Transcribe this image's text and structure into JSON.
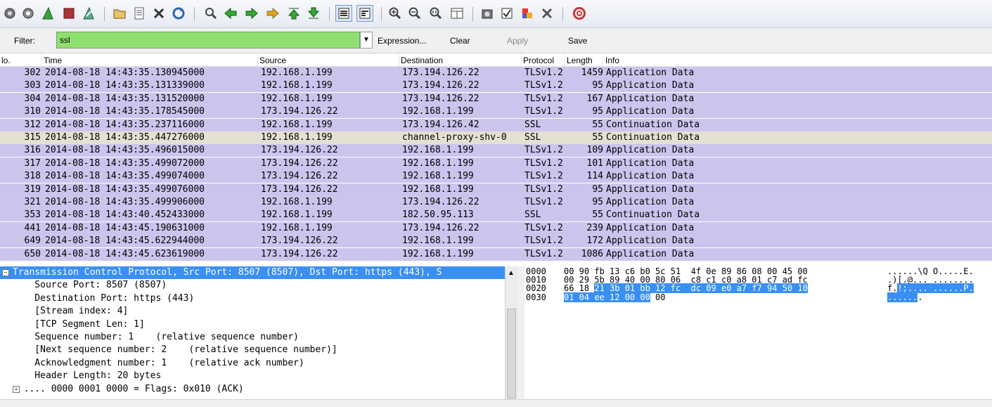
{
  "toolbar": {
    "icons": [
      "interface-list-icon",
      "capture-options-icon",
      "start-capture-icon",
      "stop-capture-icon",
      "restart-capture-icon",
      "open-file-icon",
      "save-file-icon",
      "close-file-icon",
      "reload-icon",
      "find-packet-icon",
      "go-back-icon",
      "go-forward-icon",
      "go-to-packet-icon",
      "go-first-icon",
      "go-last-icon",
      "colorize-icon",
      "autoscroll-icon",
      "zoom-in-icon",
      "zoom-out-icon",
      "normal-size-icon",
      "resize-columns-icon",
      "capture-filters-icon",
      "display-filters-icon",
      "coloring-rules-icon",
      "preferences-icon",
      "help-icon"
    ]
  },
  "filterbar": {
    "label": "Filter:",
    "value": "ssl",
    "expression": "Expression...",
    "clear": "Clear",
    "apply": "Apply",
    "save": "Save"
  },
  "packet_list": {
    "columns": [
      "lo.",
      "Time",
      "Source",
      "Destination",
      "Protocol",
      "Length",
      "Info"
    ],
    "rows": [
      {
        "no": "302",
        "time": "2014-08-18 14:43:35.130945000",
        "src": "192.168.1.199",
        "dst": "173.194.126.22",
        "proto": "TLSv1.2",
        "len": "1459",
        "info": "Application Data"
      },
      {
        "no": "303",
        "time": "2014-08-18 14:43:35.131339000",
        "src": "192.168.1.199",
        "dst": "173.194.126.22",
        "proto": "TLSv1.2",
        "len": "95",
        "info": "Application Data"
      },
      {
        "no": "304",
        "time": "2014-08-18 14:43:35.131520000",
        "src": "192.168.1.199",
        "dst": "173.194.126.22",
        "proto": "TLSv1.2",
        "len": "167",
        "info": "Application Data"
      },
      {
        "no": "310",
        "time": "2014-08-18 14:43:35.178545000",
        "src": "173.194.126.22",
        "dst": "192.168.1.199",
        "proto": "TLSv1.2",
        "len": "95",
        "info": "Application Data"
      },
      {
        "no": "312",
        "time": "2014-08-18 14:43:35.237116000",
        "src": "192.168.1.199",
        "dst": "173.194.126.42",
        "proto": "SSL",
        "len": "55",
        "info": "Continuation Data"
      },
      {
        "no": "315",
        "time": "2014-08-18 14:43:35.447276000",
        "src": "192.168.1.199",
        "dst": "channel-proxy-shv-0",
        "proto": "SSL",
        "len": "55",
        "info": "Continuation Data"
      },
      {
        "no": "316",
        "time": "2014-08-18 14:43:35.496015000",
        "src": "173.194.126.22",
        "dst": "192.168.1.199",
        "proto": "TLSv1.2",
        "len": "109",
        "info": "Application Data"
      },
      {
        "no": "317",
        "time": "2014-08-18 14:43:35.499072000",
        "src": "173.194.126.22",
        "dst": "192.168.1.199",
        "proto": "TLSv1.2",
        "len": "101",
        "info": "Application Data"
      },
      {
        "no": "318",
        "time": "2014-08-18 14:43:35.499074000",
        "src": "173.194.126.22",
        "dst": "192.168.1.199",
        "proto": "TLSv1.2",
        "len": "114",
        "info": "Application Data"
      },
      {
        "no": "319",
        "time": "2014-08-18 14:43:35.499076000",
        "src": "173.194.126.22",
        "dst": "192.168.1.199",
        "proto": "TLSv1.2",
        "len": "95",
        "info": "Application Data"
      },
      {
        "no": "321",
        "time": "2014-08-18 14:43:35.499906000",
        "src": "192.168.1.199",
        "dst": "173.194.126.22",
        "proto": "TLSv1.2",
        "len": "95",
        "info": "Application Data"
      },
      {
        "no": "353",
        "time": "2014-08-18 14:43:40.452433000",
        "src": "192.168.1.199",
        "dst": "182.50.95.113",
        "proto": "SSL",
        "len": "55",
        "info": "Continuation Data"
      },
      {
        "no": "441",
        "time": "2014-08-18 14:43:45.190631000",
        "src": "192.168.1.199",
        "dst": "173.194.126.22",
        "proto": "TLSv1.2",
        "len": "239",
        "info": "Application Data"
      },
      {
        "no": "649",
        "time": "2014-08-18 14:43:45.622944000",
        "src": "173.194.126.22",
        "dst": "192.168.1.199",
        "proto": "TLSv1.2",
        "len": "172",
        "info": "Application Data"
      },
      {
        "no": "650",
        "time": "2014-08-18 14:43:45.623619000",
        "src": "173.194.126.22",
        "dst": "192.168.1.199",
        "proto": "TLSv1.2",
        "len": "1086",
        "info": "Application Data"
      }
    ],
    "selected_no": "315"
  },
  "detail": {
    "lines": [
      "Transmission Control Protocol, Src Port: 8507 (8507), Dst Port: https (443), S",
      "    Source Port: 8507 (8507)",
      "    Destination Port: https (443)",
      "    [Stream index: 4]",
      "    [TCP Segment Len: 1]",
      "    Sequence number: 1    (relative sequence number)",
      "    [Next sequence number: 2    (relative sequence number)]",
      "    Acknowledgment number: 1    (relative ack number)",
      "    Header Length: 20 bytes",
      "  .... 0000 0001 0000 = Flags: 0x010 (ACK)"
    ]
  },
  "bytes": {
    "offsets": [
      "0000",
      "0010",
      "0020",
      "0030"
    ],
    "rows": [
      {
        "pre": "00 90 fb 13 c6 b0 5c 51  4f 0e 89 86 08 00 45 00",
        "hl": "",
        "post": ""
      },
      {
        "pre": "00 29 5b 89 40 00 80 06  c8 c1 c0 a8 01 c7 ad fc",
        "hl": "",
        "post": ""
      },
      {
        "pre": "66 18 ",
        "hl": "21 3b 01 bb 12 fc  dc 09 e0 a7 f7 94 50 10",
        "post": ""
      },
      {
        "pre": "",
        "hl": "01 04 ee 12 00 00",
        "post": " 00"
      }
    ],
    "ascii": [
      {
        "pre": "......\\Q O.....E.",
        "hl": ""
      },
      {
        "pre": ".)[.@... ........",
        "hl": ""
      },
      {
        "pre": "f.",
        "hl": "!;.... ......P."
      },
      {
        "pre": "",
        "hl": "......",
        "post": "."
      }
    ]
  },
  "colors": {
    "row_bg": "#cbc5ee",
    "selected_row_bg": "#e4e0d2",
    "filter_bg": "#90e070",
    "selection_blue": "#3a8ff2"
  }
}
